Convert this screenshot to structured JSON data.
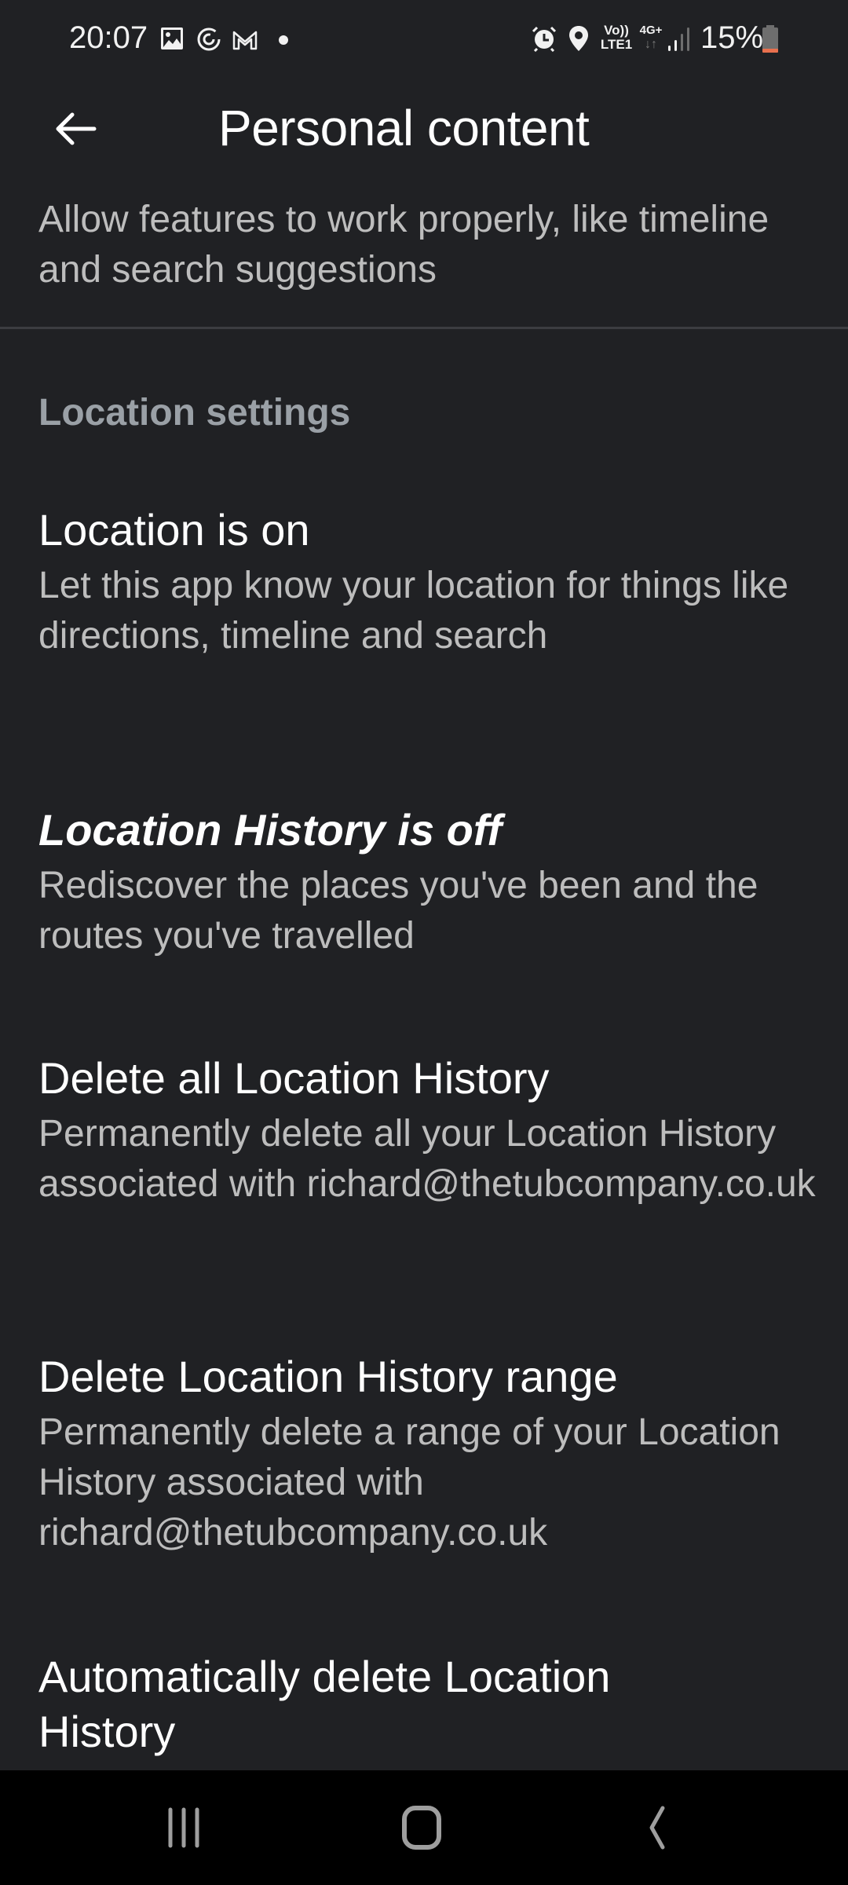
{
  "status_bar": {
    "time": "20:07",
    "left_icons": [
      "gallery-icon",
      "sync-icon",
      "gmail-icon",
      "notification-dot-icon"
    ],
    "right_icons": [
      "alarm-icon",
      "location-pin-icon",
      "volte-lte1-icon",
      "4g-plus-data-icon",
      "signal-icon",
      "battery-icon"
    ],
    "volte_label_top": "Vo))",
    "volte_label_bottom": "LTE1",
    "network_label": "4G+",
    "battery_percent": "15%",
    "battery_level": 0.15,
    "battery_color": "#e8704e"
  },
  "app_bar": {
    "title": "Personal content",
    "back_icon": "arrow-back-icon"
  },
  "content": {
    "top_description": "Allow features to work properly, like timeline and search suggestions",
    "section_header": "Location settings",
    "items": [
      {
        "title": "Location is on",
        "summary": "Let this app know your location for things like directions, timeline and search"
      },
      {
        "title": "Location History is off",
        "summary": "Rediscover the places you've been and the routes you've travelled"
      },
      {
        "title": "Delete all Location History",
        "summary": "Permanently delete all your Location History associated with richard@thetubcompany.co.uk"
      },
      {
        "title": "Delete Location History range",
        "summary": "Permanently delete a range of your Location History associated with richard@thetubcompany.co.uk"
      },
      {
        "title": "Automatically delete Location History",
        "summary": ""
      }
    ]
  },
  "nav_bar": {
    "recents_icon": "recents-icon",
    "home_icon": "home-icon",
    "back_icon": "nav-back-icon"
  },
  "colors": {
    "background": "#202124",
    "title_text": "#ffffff",
    "secondary_text": "#bdbdbd",
    "section_header": "#9aa0a6",
    "nav_bar": "#000000"
  }
}
